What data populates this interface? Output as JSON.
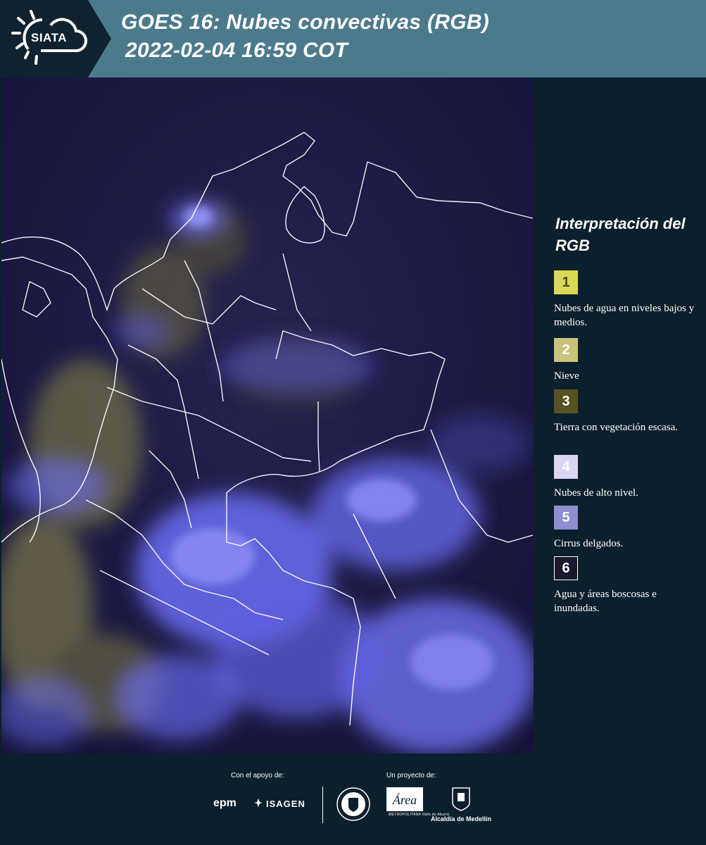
{
  "header": {
    "logo_text": "SIATA",
    "title_line1": "GOES 16: Nubes convectivas (RGB)",
    "title_line2": "2022-02-04 16:59 COT",
    "bg_color": "#4b7a8b"
  },
  "map": {
    "description_icon": "satellite-map",
    "base_color": "#1d1a4a",
    "cloud_color": "#6a6cf2",
    "land_tint": "#8f8c4a"
  },
  "legend": {
    "title": "Interpretación del RGB",
    "items": [
      {
        "number": "1",
        "color": "#d9d955",
        "label": "Nubes de agua en niveles bajos y medios."
      },
      {
        "number": "2",
        "color": "#c8c47a",
        "label": "Nieve"
      },
      {
        "number": "3",
        "color": "#575223",
        "label": "Tierra con vegetación escasa."
      },
      {
        "number": "4",
        "color": "#d8d6f4",
        "label": "Nubes de alto nivel."
      },
      {
        "number": "5",
        "color": "#8e8ed0",
        "label": "Cirrus delgados."
      },
      {
        "number": "6",
        "color": "#1a1a2e",
        "label": "Agua y áreas boscosas e inundadas."
      }
    ]
  },
  "footer": {
    "support_label": "Con el apoyo de:",
    "project_label": "Un proyecto de:",
    "sponsor1": "epm",
    "sponsor2": "ISAGEN",
    "area_name": "Área",
    "area_subtitle": "METROPOLITANA Valle de Aburrá",
    "alcaldia": "Alcaldía de Medellín"
  }
}
